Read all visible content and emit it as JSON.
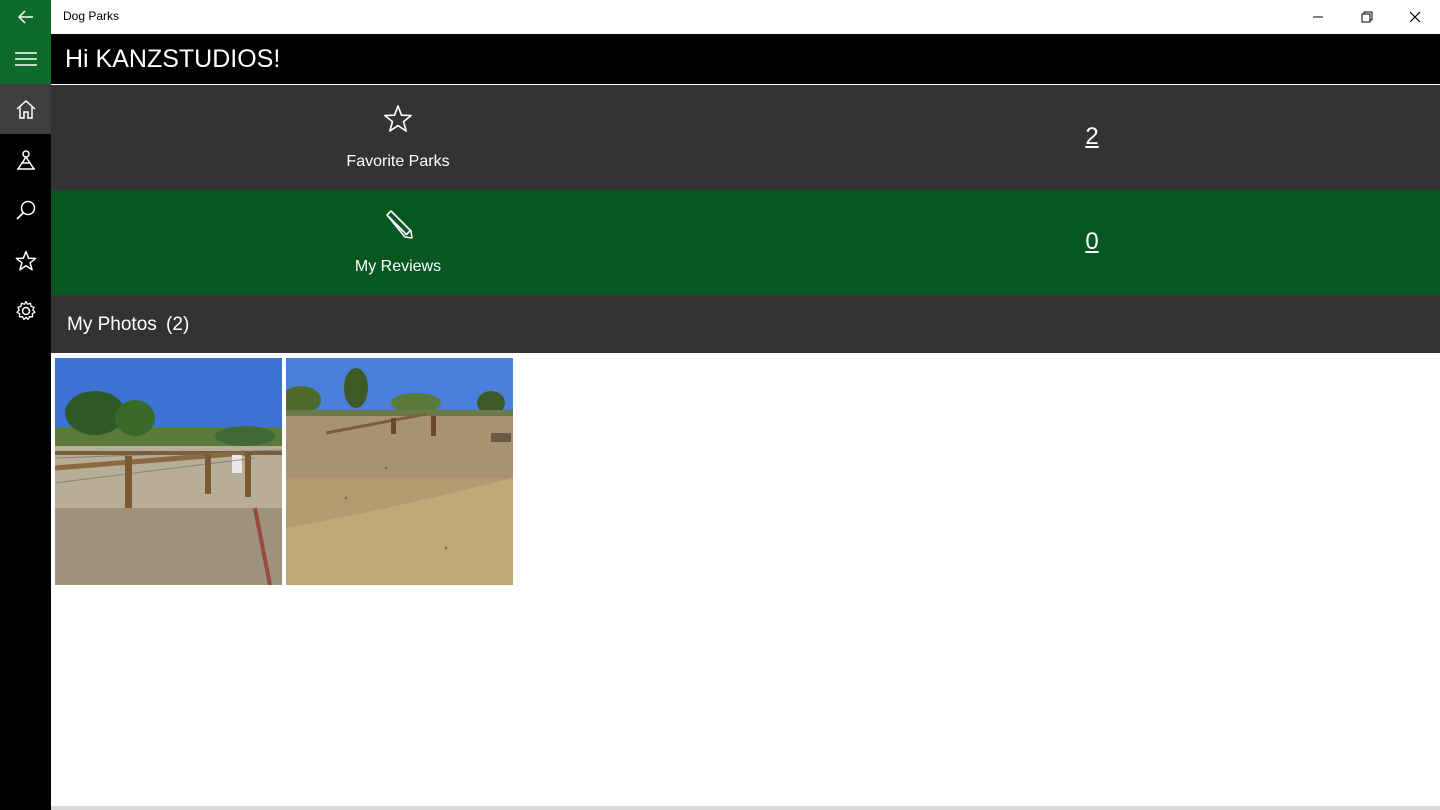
{
  "window": {
    "title": "Dog Parks",
    "colors": {
      "accent": "#0f6b2a",
      "dark": "#333333",
      "reviews_bg": "#075722"
    }
  },
  "nav": {
    "items": [
      {
        "icon": "hamburger-icon"
      },
      {
        "icon": "home-icon",
        "selected": true
      },
      {
        "icon": "dog-park-icon"
      },
      {
        "icon": "search-icon"
      },
      {
        "icon": "star-icon"
      },
      {
        "icon": "gear-icon"
      }
    ]
  },
  "header": {
    "greeting": "Hi KANZSTUDIOS!"
  },
  "stats": {
    "favorites": {
      "label": "Favorite Parks",
      "count": "2",
      "icon": "star-outline-icon"
    },
    "reviews": {
      "label": "My Reviews",
      "count": "0",
      "icon": "pencil-icon"
    }
  },
  "photos": {
    "title": "My Photos",
    "count": "(2)",
    "items": [
      {
        "alt": "dog-park-fence-photo"
      },
      {
        "alt": "dog-park-wood-chips-photo"
      }
    ]
  }
}
